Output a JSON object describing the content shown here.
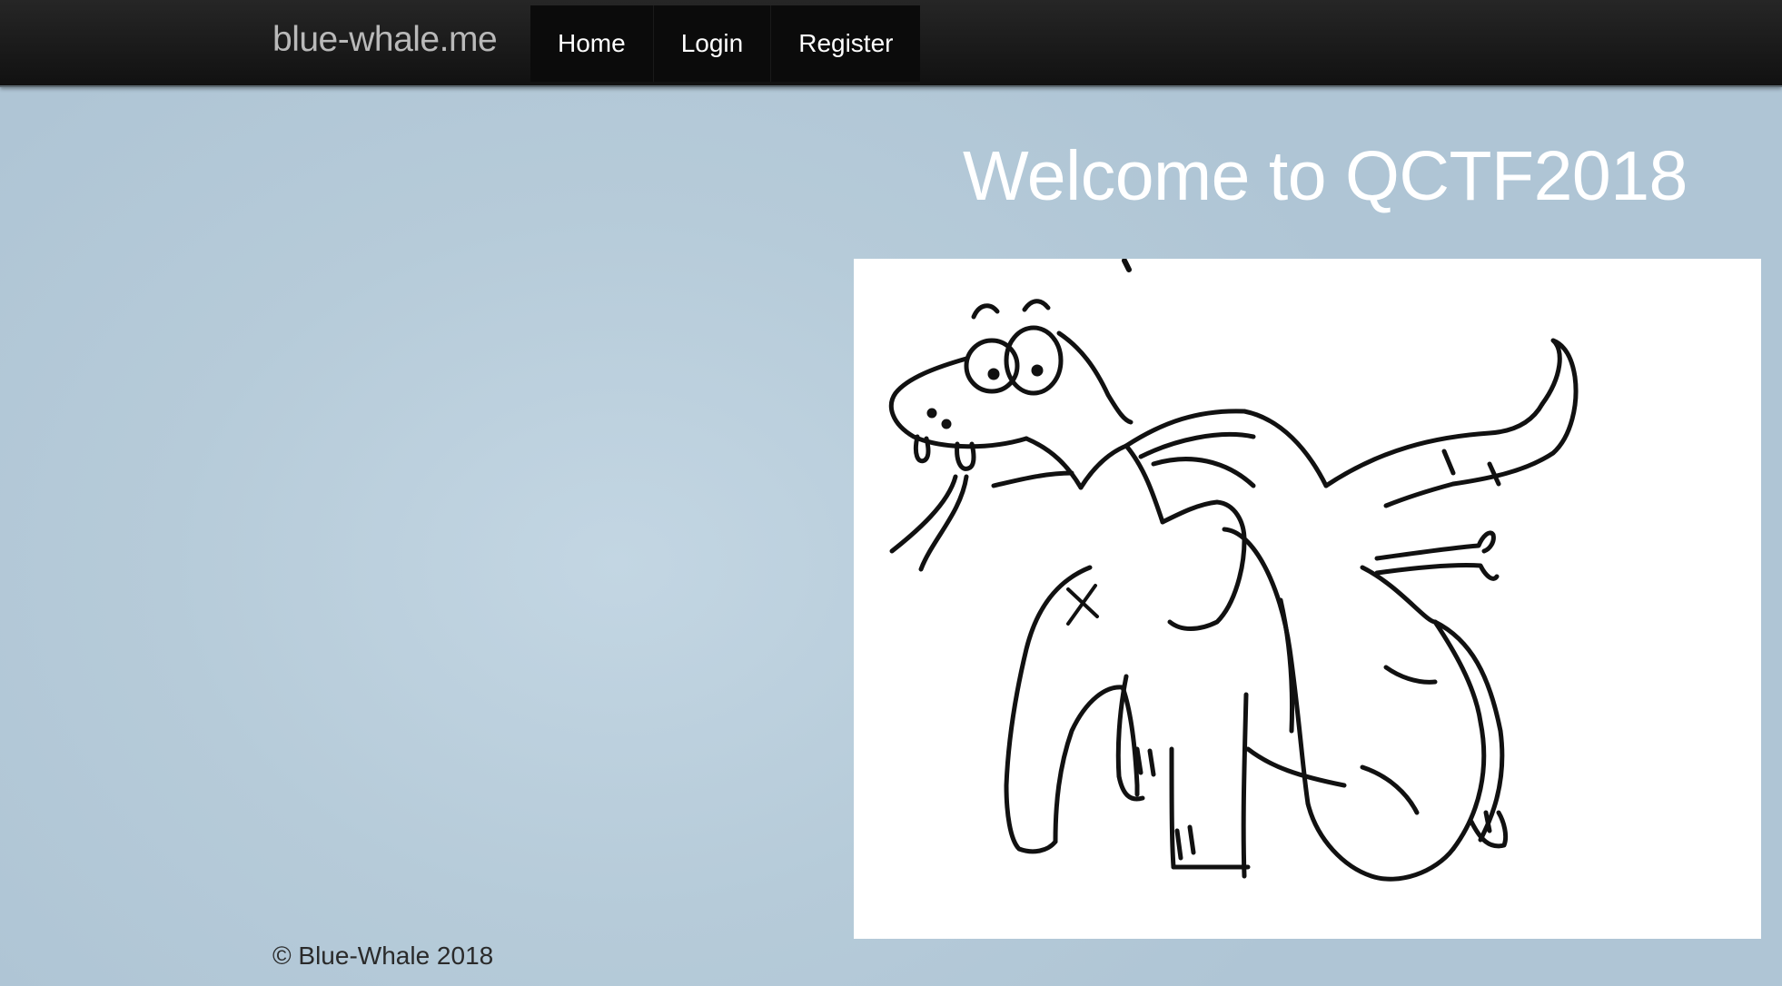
{
  "brand": "blue-whale.me",
  "nav": {
    "items": [
      {
        "label": "Home"
      },
      {
        "label": "Login"
      },
      {
        "label": "Register"
      }
    ]
  },
  "main": {
    "heading": "Welcome to QCTF2018",
    "illustration_icon": "crocodile-sketch-illustration"
  },
  "footer": {
    "copyright": "© Blue-Whale 2018"
  },
  "colors": {
    "navbar": "#1a1a1a",
    "background": "#b6cbd9",
    "heading": "#ffffff"
  }
}
